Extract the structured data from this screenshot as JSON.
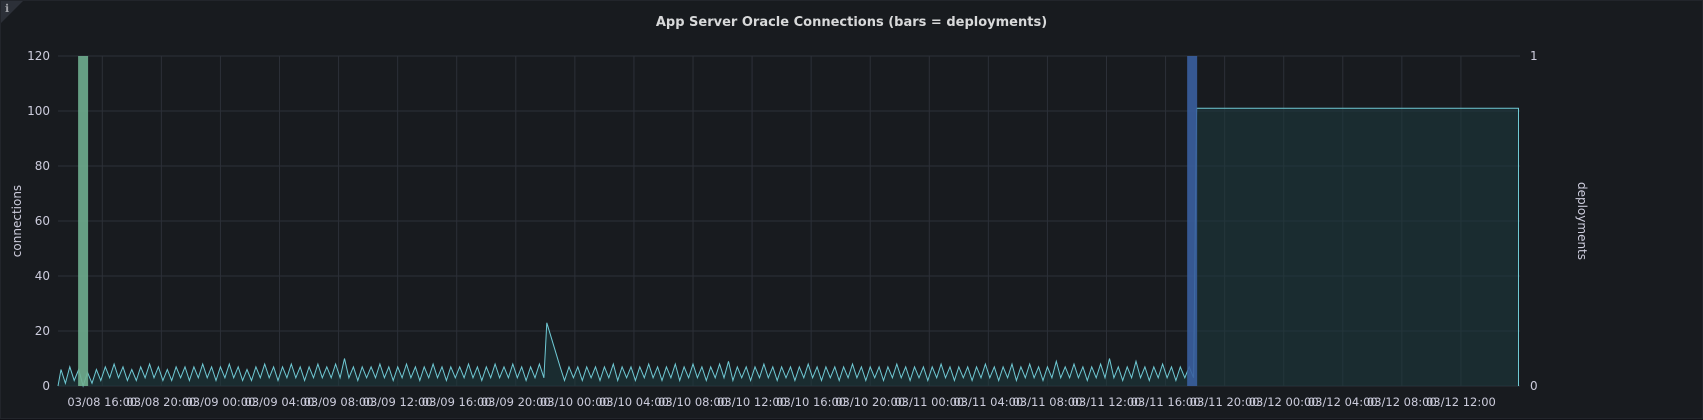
{
  "panel": {
    "title": "App Server Oracle Connections (bars = deployments)",
    "info_icon": "info-icon"
  },
  "chart_data": {
    "type": "line",
    "title": "App Server Oracle Connections (bars = deployments)",
    "xlabel": "",
    "ylabel": "connections",
    "y2label": "deployments",
    "ylim": [
      0,
      120
    ],
    "y2lim": [
      0,
      1
    ],
    "yticks": [
      0,
      20,
      40,
      60,
      80,
      100,
      120
    ],
    "y2ticks": [
      0,
      1
    ],
    "xticks": [
      "03/08 16:00",
      "03/08 20:00",
      "03/09 00:00",
      "03/09 04:00",
      "03/09 08:00",
      "03/09 12:00",
      "03/09 16:00",
      "03/09 20:00",
      "03/10 00:00",
      "03/10 04:00",
      "03/10 08:00",
      "03/10 12:00",
      "03/10 16:00",
      "03/10 20:00",
      "03/11 00:00",
      "03/11 04:00",
      "03/11 08:00",
      "03/11 12:00",
      "03/11 16:00",
      "03/11 20:00",
      "03/12 00:00",
      "03/12 04:00",
      "03/12 08:00",
      "03/12 12:00"
    ],
    "xrange_hours": [
      -3,
      96
    ],
    "grid": true,
    "colors": {
      "line": "#6fc9d4",
      "fill": "#1e3a3e",
      "bar_green": "#6fae8f",
      "bar_blue": "#3a5f9e",
      "grid": "#2c3038",
      "text": "#ccccdc"
    },
    "series": [
      {
        "axis": "left",
        "points": [
          [
            -3.0,
            0
          ],
          [
            -2.8,
            6
          ],
          [
            -2.5,
            1
          ],
          [
            -2.2,
            7
          ],
          [
            -1.9,
            2
          ],
          [
            -1.6,
            6
          ],
          [
            -1.3,
            0
          ],
          [
            -1.0,
            5
          ],
          [
            -0.7,
            1
          ],
          [
            -0.4,
            6
          ],
          [
            -0.1,
            2
          ],
          [
            0.2,
            7
          ],
          [
            0.5,
            3
          ],
          [
            0.8,
            8
          ],
          [
            1.1,
            3
          ],
          [
            1.4,
            7
          ],
          [
            1.7,
            2
          ],
          [
            2.0,
            6
          ],
          [
            2.3,
            2
          ],
          [
            2.6,
            7
          ],
          [
            2.9,
            3
          ],
          [
            3.2,
            8
          ],
          [
            3.5,
            3
          ],
          [
            3.8,
            7
          ],
          [
            4.1,
            2
          ],
          [
            4.4,
            6
          ],
          [
            4.7,
            2
          ],
          [
            5.0,
            7
          ],
          [
            5.3,
            3
          ],
          [
            5.6,
            7
          ],
          [
            5.9,
            2
          ],
          [
            6.2,
            7
          ],
          [
            6.5,
            3
          ],
          [
            6.8,
            8
          ],
          [
            7.1,
            3
          ],
          [
            7.4,
            7
          ],
          [
            7.7,
            2
          ],
          [
            8.0,
            7
          ],
          [
            8.3,
            3
          ],
          [
            8.6,
            8
          ],
          [
            8.9,
            3
          ],
          [
            9.2,
            7
          ],
          [
            9.5,
            2
          ],
          [
            9.8,
            6
          ],
          [
            10.1,
            2
          ],
          [
            10.4,
            7
          ],
          [
            10.7,
            3
          ],
          [
            11.0,
            8
          ],
          [
            11.3,
            3
          ],
          [
            11.6,
            7
          ],
          [
            11.9,
            2
          ],
          [
            12.2,
            7
          ],
          [
            12.5,
            3
          ],
          [
            12.8,
            8
          ],
          [
            13.1,
            3
          ],
          [
            13.4,
            7
          ],
          [
            13.7,
            2
          ],
          [
            14.0,
            7
          ],
          [
            14.3,
            3
          ],
          [
            14.6,
            8
          ],
          [
            14.9,
            3
          ],
          [
            15.2,
            7
          ],
          [
            15.5,
            3
          ],
          [
            15.8,
            8
          ],
          [
            16.1,
            3
          ],
          [
            16.4,
            10
          ],
          [
            16.7,
            3
          ],
          [
            17.0,
            7
          ],
          [
            17.3,
            2
          ],
          [
            17.6,
            7
          ],
          [
            17.9,
            3
          ],
          [
            18.2,
            7
          ],
          [
            18.5,
            3
          ],
          [
            18.8,
            8
          ],
          [
            19.1,
            3
          ],
          [
            19.4,
            7
          ],
          [
            19.7,
            2
          ],
          [
            20.0,
            7
          ],
          [
            20.3,
            3
          ],
          [
            20.6,
            8
          ],
          [
            20.9,
            3
          ],
          [
            21.2,
            7
          ],
          [
            21.5,
            2
          ],
          [
            21.8,
            7
          ],
          [
            22.1,
            3
          ],
          [
            22.4,
            8
          ],
          [
            22.7,
            3
          ],
          [
            23.0,
            7
          ],
          [
            23.3,
            2
          ],
          [
            23.6,
            7
          ],
          [
            23.9,
            3
          ],
          [
            24.2,
            7
          ],
          [
            24.5,
            3
          ],
          [
            24.8,
            8
          ],
          [
            25.1,
            3
          ],
          [
            25.4,
            7
          ],
          [
            25.7,
            2
          ],
          [
            26.0,
            7
          ],
          [
            26.3,
            3
          ],
          [
            26.6,
            8
          ],
          [
            26.9,
            3
          ],
          [
            27.2,
            7
          ],
          [
            27.5,
            3
          ],
          [
            27.8,
            8
          ],
          [
            28.1,
            3
          ],
          [
            28.4,
            7
          ],
          [
            28.7,
            2
          ],
          [
            29.0,
            7
          ],
          [
            29.3,
            3
          ],
          [
            29.6,
            8
          ],
          [
            29.9,
            3
          ],
          [
            30.1,
            23
          ],
          [
            31.0,
            7
          ],
          [
            31.3,
            2
          ],
          [
            31.6,
            7
          ],
          [
            31.9,
            3
          ],
          [
            32.2,
            7
          ],
          [
            32.5,
            2
          ],
          [
            32.8,
            7
          ],
          [
            33.1,
            3
          ],
          [
            33.4,
            7
          ],
          [
            33.7,
            2
          ],
          [
            34.0,
            7
          ],
          [
            34.3,
            3
          ],
          [
            34.6,
            8
          ],
          [
            34.9,
            2
          ],
          [
            35.2,
            7
          ],
          [
            35.5,
            3
          ],
          [
            35.8,
            7
          ],
          [
            36.1,
            2
          ],
          [
            36.4,
            7
          ],
          [
            36.7,
            3
          ],
          [
            37.0,
            8
          ],
          [
            37.3,
            3
          ],
          [
            37.6,
            7
          ],
          [
            37.9,
            2
          ],
          [
            38.2,
            7
          ],
          [
            38.5,
            3
          ],
          [
            38.8,
            8
          ],
          [
            39.1,
            2
          ],
          [
            39.4,
            7
          ],
          [
            39.7,
            3
          ],
          [
            40.0,
            8
          ],
          [
            40.3,
            3
          ],
          [
            40.6,
            7
          ],
          [
            40.9,
            2
          ],
          [
            41.2,
            7
          ],
          [
            41.5,
            3
          ],
          [
            41.8,
            8
          ],
          [
            42.1,
            3
          ],
          [
            42.4,
            9
          ],
          [
            42.7,
            2
          ],
          [
            43.0,
            7
          ],
          [
            43.3,
            3
          ],
          [
            43.6,
            7
          ],
          [
            43.9,
            2
          ],
          [
            44.2,
            7
          ],
          [
            44.5,
            3
          ],
          [
            44.8,
            8
          ],
          [
            45.1,
            3
          ],
          [
            45.4,
            7
          ],
          [
            45.7,
            2
          ],
          [
            46.0,
            7
          ],
          [
            46.3,
            3
          ],
          [
            46.6,
            7
          ],
          [
            46.9,
            2
          ],
          [
            47.2,
            7
          ],
          [
            47.5,
            3
          ],
          [
            47.8,
            8
          ],
          [
            48.1,
            3
          ],
          [
            48.4,
            7
          ],
          [
            48.7,
            2
          ],
          [
            49.0,
            7
          ],
          [
            49.3,
            3
          ],
          [
            49.6,
            7
          ],
          [
            49.9,
            2
          ],
          [
            50.2,
            7
          ],
          [
            50.5,
            3
          ],
          [
            50.8,
            8
          ],
          [
            51.1,
            3
          ],
          [
            51.4,
            7
          ],
          [
            51.7,
            2
          ],
          [
            52.0,
            7
          ],
          [
            52.3,
            3
          ],
          [
            52.6,
            7
          ],
          [
            52.9,
            2
          ],
          [
            53.2,
            7
          ],
          [
            53.5,
            3
          ],
          [
            53.8,
            8
          ],
          [
            54.1,
            3
          ],
          [
            54.4,
            7
          ],
          [
            54.7,
            2
          ],
          [
            55.0,
            7
          ],
          [
            55.3,
            3
          ],
          [
            55.6,
            7
          ],
          [
            55.9,
            2
          ],
          [
            56.2,
            7
          ],
          [
            56.5,
            3
          ],
          [
            56.8,
            8
          ],
          [
            57.1,
            3
          ],
          [
            57.4,
            7
          ],
          [
            57.7,
            2
          ],
          [
            58.0,
            7
          ],
          [
            58.3,
            3
          ],
          [
            58.6,
            7
          ],
          [
            58.9,
            2
          ],
          [
            59.2,
            7
          ],
          [
            59.5,
            3
          ],
          [
            59.8,
            8
          ],
          [
            60.1,
            3
          ],
          [
            60.4,
            7
          ],
          [
            60.7,
            2
          ],
          [
            61.0,
            7
          ],
          [
            61.3,
            3
          ],
          [
            61.6,
            8
          ],
          [
            61.9,
            2
          ],
          [
            62.2,
            7
          ],
          [
            62.5,
            3
          ],
          [
            62.8,
            8
          ],
          [
            63.1,
            3
          ],
          [
            63.4,
            7
          ],
          [
            63.7,
            2
          ],
          [
            64.0,
            7
          ],
          [
            64.3,
            3
          ],
          [
            64.6,
            9
          ],
          [
            64.9,
            3
          ],
          [
            65.2,
            7
          ],
          [
            65.5,
            3
          ],
          [
            65.8,
            8
          ],
          [
            66.1,
            3
          ],
          [
            66.4,
            7
          ],
          [
            66.7,
            2
          ],
          [
            67.0,
            7
          ],
          [
            67.3,
            3
          ],
          [
            67.6,
            8
          ],
          [
            67.9,
            3
          ],
          [
            68.2,
            10
          ],
          [
            68.5,
            3
          ],
          [
            68.8,
            7
          ],
          [
            69.1,
            2
          ],
          [
            69.4,
            7
          ],
          [
            69.7,
            3
          ],
          [
            70.0,
            9
          ],
          [
            70.3,
            3
          ],
          [
            70.6,
            7
          ],
          [
            70.9,
            2
          ],
          [
            71.2,
            7
          ],
          [
            71.5,
            3
          ],
          [
            71.8,
            8
          ],
          [
            72.1,
            3
          ],
          [
            72.4,
            7
          ],
          [
            72.7,
            2
          ],
          [
            73.0,
            7
          ],
          [
            73.3,
            3
          ],
          [
            73.6,
            7
          ],
          [
            73.9,
            3
          ],
          [
            74.1,
            101
          ],
          [
            95.9,
            101
          ],
          [
            95.9,
            0
          ]
        ]
      },
      {
        "axis": "right",
        "kind": "bar",
        "points": [
          [
            -1.3,
            1,
            "#6fae8f"
          ],
          [
            73.8,
            1,
            "#3a5f9e"
          ]
        ]
      }
    ]
  }
}
